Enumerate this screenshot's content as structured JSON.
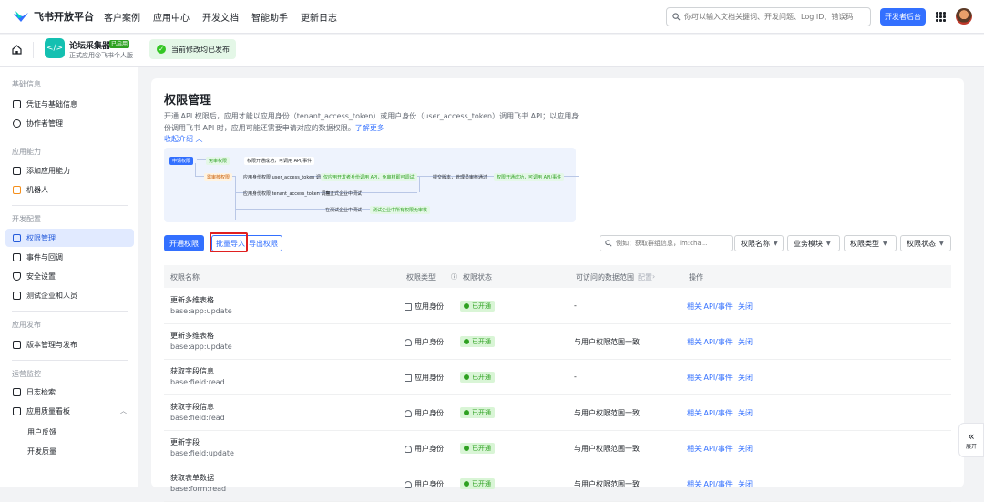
{
  "nav": {
    "logo": "飞书开放平台",
    "items": [
      "客户案例",
      "应用中心",
      "开发文档",
      "智能助手",
      "更新日志"
    ],
    "search_placeholder": "你可以输入文档关键词、开发问题、Log ID、错误码",
    "dev_console": "开发者后台"
  },
  "appbar": {
    "app_name": "论坛采集器",
    "app_badge": "已启用",
    "app_sub": "正式应用@飞书个人版",
    "toast": "当前修改均已发布"
  },
  "sidebar": {
    "groups": [
      {
        "title": "基础信息",
        "items": [
          "凭证与基础信息",
          "协作者管理"
        ]
      },
      {
        "title": "应用能力",
        "items": [
          "添加应用能力",
          "机器人"
        ]
      },
      {
        "title": "开发配置",
        "items": [
          "权限管理",
          "事件与回调",
          "安全设置",
          "测试企业和人员"
        ]
      },
      {
        "title": "应用发布",
        "items": [
          "版本管理与发布"
        ]
      },
      {
        "title": "运营监控",
        "items": [
          "日志检索",
          "应用质量看板"
        ]
      }
    ],
    "subitems": [
      "用户反馈",
      "开发质量"
    ]
  },
  "page": {
    "title": "权限管理",
    "desc": "开通 API 权限后，应用才能以应用身份（tenant_access_token）或用户身份（user_access_token）调用飞书 API；以应用身份调用飞书 API 时，应用可能还需要申请对应的数据权限。",
    "learn_more": "了解更多",
    "collapse": "收起介绍"
  },
  "flow": {
    "start": "申请权限",
    "branch1": "免审权限",
    "branch2": "需审核权限",
    "done1": "权限开通成功，可调用 API/事件",
    "sub_app": "应用身份权限 user_access_token 调用",
    "sub_app2": "应用身份权限 tenant_access_token 调用",
    "mid": "仅应用开发者身份调用 API，免审核即可调试",
    "submit": "提交版本，管理员审核通过",
    "done2": "权限开通成功，可调用 API/事件",
    "enterprise": "在正式企业中调试",
    "test_enterprise": "在测试企业中调试",
    "test_done": "测试企业中所有权限免审核"
  },
  "actions": {
    "open": "开通权限",
    "import": "批量导入",
    "export": "导出权限",
    "filter_placeholder": "例如：获取群组信息，im:cha...",
    "filters": [
      "权限名称",
      "业务模块",
      "权限类型",
      "权限状态"
    ]
  },
  "table": {
    "headers": [
      "权限名称",
      "权限类型",
      "权限状态",
      "可访问的数据范围",
      "配置",
      "操作"
    ],
    "rows": [
      {
        "name": "更新多维表格",
        "code": "base:app:update",
        "type": "应用身份",
        "status": "已开通",
        "scope": "-",
        "op1": "相关 API/事件",
        "op2": "关闭",
        "kind": "app"
      },
      {
        "name": "更新多维表格",
        "code": "base:app:update",
        "type": "用户身份",
        "status": "已开通",
        "scope": "与用户权限范围一致",
        "op1": "相关 API/事件",
        "op2": "关闭",
        "kind": "user"
      },
      {
        "name": "获取字段信息",
        "code": "base:field:read",
        "type": "应用身份",
        "status": "已开通",
        "scope": "-",
        "op1": "相关 API/事件",
        "op2": "关闭",
        "kind": "app"
      },
      {
        "name": "获取字段信息",
        "code": "base:field:read",
        "type": "用户身份",
        "status": "已开通",
        "scope": "与用户权限范围一致",
        "op1": "相关 API/事件",
        "op2": "关闭",
        "kind": "user"
      },
      {
        "name": "更新字段",
        "code": "base:field:update",
        "type": "用户身份",
        "status": "已开通",
        "scope": "与用户权限范围一致",
        "op1": "相关 API/事件",
        "op2": "关闭",
        "kind": "user"
      },
      {
        "name": "获取表单数据",
        "code": "base:form:read",
        "type": "用户身份",
        "status": "已开通",
        "scope": "与用户权限范围一致",
        "op1": "相关 API/事件",
        "op2": "关闭",
        "kind": "user"
      }
    ]
  },
  "expand_label": "展开",
  "colors": {
    "primary": "#3370ff",
    "success": "#2ea121",
    "highlight": "#e02020"
  }
}
